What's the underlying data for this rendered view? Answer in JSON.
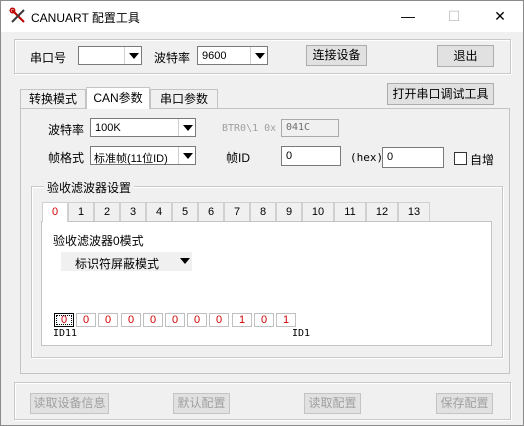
{
  "window": {
    "title": "CANUART 配置工具",
    "minimize": "—",
    "maximize": "☐",
    "close": "✕"
  },
  "toolbar": {
    "port_label": "串口号",
    "port_value": "",
    "baud_label": "波特率",
    "baud_value": "9600",
    "connect_label": "连接设备",
    "exit_label": "退出"
  },
  "tabs": [
    {
      "label": "转换模式"
    },
    {
      "label": "CAN参数"
    },
    {
      "label": "串口参数"
    }
  ],
  "open_serial_tool_label": "打开串口调试工具",
  "can": {
    "baud_label": "波特率",
    "baud_value": "100K",
    "btr_label": "BTR0\\1 0x",
    "btr_value": "041C",
    "frame_format_label": "帧格式",
    "frame_format_value": "标准帧(11位ID)",
    "frame_id_label": "帧ID",
    "frame_id_value": "0",
    "hex_label": "(hex)",
    "hex_value": "0",
    "auto_inc_label": "自增",
    "auto_inc_checked": false
  },
  "filter": {
    "group_label": "验收滤波器设置",
    "tabs": [
      "0",
      "1",
      "2",
      "3",
      "4",
      "5",
      "6",
      "7",
      "8",
      "9",
      "10",
      "11",
      "12",
      "13"
    ],
    "active_tab": 0,
    "mode_label": "验收滤波器0模式",
    "mode_value": "标识符屏蔽模式",
    "bits": [
      "0",
      "0",
      "0",
      "0",
      "0",
      "0",
      "0",
      "0",
      "1",
      "0",
      "1"
    ],
    "bit_left_label": "ID11",
    "bit_right_label": "ID1"
  },
  "bottom": {
    "read_info": "读取设备信息",
    "default_config": "默认配置",
    "read_config": "读取配置",
    "save_config": "保存配置"
  },
  "colors": {
    "accent_red": "#d00000"
  }
}
